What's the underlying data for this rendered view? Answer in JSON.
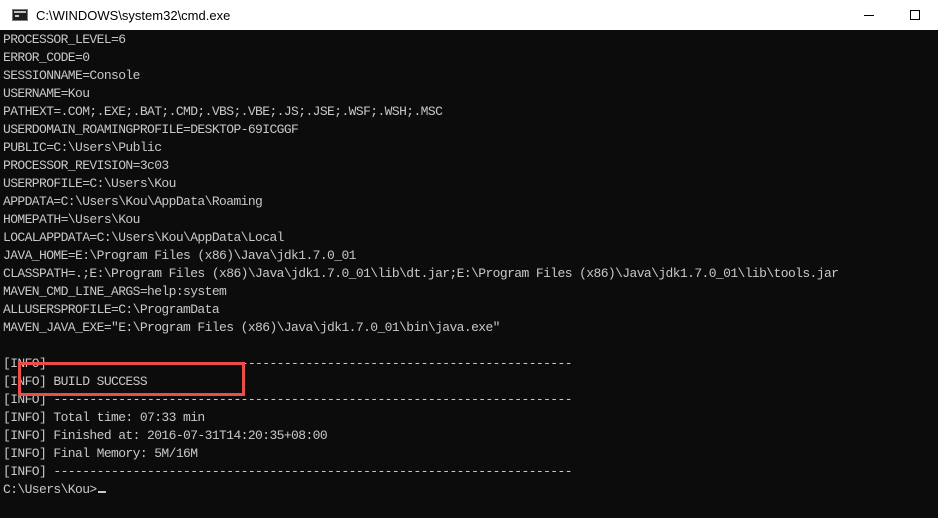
{
  "window": {
    "title": "C:\\WINDOWS\\system32\\cmd.exe",
    "app_icon": "cmd-icon",
    "controls": {
      "minimize_icon": "minimize-icon",
      "maximize_icon": "maximize-icon"
    }
  },
  "console": {
    "lines": [
      "PROCESSOR_LEVEL=6",
      "ERROR_CODE=0",
      "SESSIONNAME=Console",
      "USERNAME=Kou",
      "PATHEXT=.COM;.EXE;.BAT;.CMD;.VBS;.VBE;.JS;.JSE;.WSF;.WSH;.MSC",
      "USERDOMAIN_ROAMINGPROFILE=DESKTOP-69ICGGF",
      "PUBLIC=C:\\Users\\Public",
      "PROCESSOR_REVISION=3c03",
      "USERPROFILE=C:\\Users\\Kou",
      "APPDATA=C:\\Users\\Kou\\AppData\\Roaming",
      "HOMEPATH=\\Users\\Kou",
      "LOCALAPPDATA=C:\\Users\\Kou\\AppData\\Local",
      "JAVA_HOME=E:\\Program Files (x86)\\Java\\jdk1.7.0_01",
      "CLASSPATH=.;E:\\Program Files (x86)\\Java\\jdk1.7.0_01\\lib\\dt.jar;E:\\Program Files (x86)\\Java\\jdk1.7.0_01\\lib\\tools.jar",
      "MAVEN_CMD_LINE_ARGS=help:system",
      "ALLUSERSPROFILE=C:\\ProgramData",
      "MAVEN_JAVA_EXE=\"E:\\Program Files (x86)\\Java\\jdk1.7.0_01\\bin\\java.exe\"",
      "",
      "[INFO] ------------------------------------------------------------------------",
      "[INFO] BUILD SUCCESS",
      "[INFO] ------------------------------------------------------------------------",
      "[INFO] Total time: 07:33 min",
      "[INFO] Finished at: 2016-07-31T14:20:35+08:00",
      "[INFO] Final Memory: 5M/16M",
      "[INFO] ------------------------------------------------------------------------"
    ],
    "prompt": "C:\\Users\\Kou>"
  },
  "colors": {
    "console_background": "#0c0c0c",
    "console_text": "#c8c8c8",
    "highlight_border": "#ef4b4b"
  }
}
